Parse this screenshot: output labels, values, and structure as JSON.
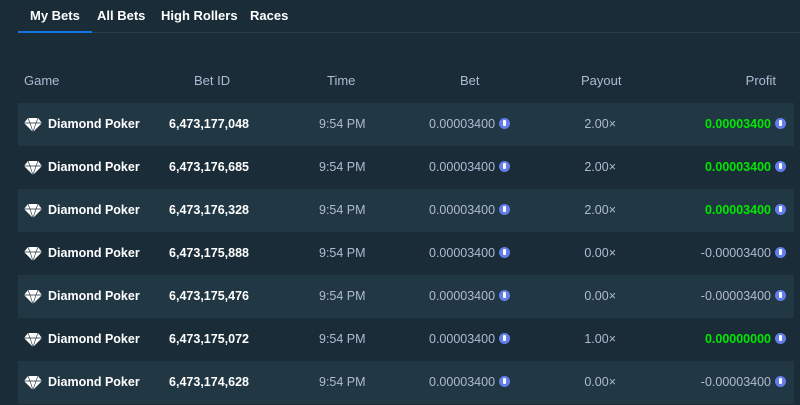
{
  "tabs": [
    {
      "label": "My Bets",
      "active": true
    },
    {
      "label": "All Bets",
      "active": false
    },
    {
      "label": "High Rollers",
      "active": false
    },
    {
      "label": "Races",
      "active": false
    }
  ],
  "columns": {
    "game": "Game",
    "bet_id": "Bet ID",
    "time": "Time",
    "bet": "Bet",
    "payout": "Payout",
    "profit": "Profit"
  },
  "rows": [
    {
      "game": "Diamond Poker",
      "bet_id": "6,473,177,048",
      "time": "9:54 PM",
      "bet": "0.00003400",
      "payout": "2.00×",
      "profit": "0.00003400",
      "profit_sign": "pos"
    },
    {
      "game": "Diamond Poker",
      "bet_id": "6,473,176,685",
      "time": "9:54 PM",
      "bet": "0.00003400",
      "payout": "2.00×",
      "profit": "0.00003400",
      "profit_sign": "pos"
    },
    {
      "game": "Diamond Poker",
      "bet_id": "6,473,176,328",
      "time": "9:54 PM",
      "bet": "0.00003400",
      "payout": "2.00×",
      "profit": "0.00003400",
      "profit_sign": "pos"
    },
    {
      "game": "Diamond Poker",
      "bet_id": "6,473,175,888",
      "time": "9:54 PM",
      "bet": "0.00003400",
      "payout": "0.00×",
      "profit": "-0.00003400",
      "profit_sign": "neg"
    },
    {
      "game": "Diamond Poker",
      "bet_id": "6,473,175,476",
      "time": "9:54 PM",
      "bet": "0.00003400",
      "payout": "0.00×",
      "profit": "-0.00003400",
      "profit_sign": "neg"
    },
    {
      "game": "Diamond Poker",
      "bet_id": "6,473,175,072",
      "time": "9:54 PM",
      "bet": "0.00003400",
      "payout": "1.00×",
      "profit": "0.00000000",
      "profit_sign": "pos"
    },
    {
      "game": "Diamond Poker",
      "bet_id": "6,473,174,628",
      "time": "9:54 PM",
      "bet": "0.00003400",
      "payout": "0.00×",
      "profit": "-0.00003400",
      "profit_sign": "neg"
    }
  ],
  "icons": {
    "game": "diamond-icon",
    "currency": "ethereum-coin-icon"
  },
  "colors": {
    "background": "#1a2c38",
    "row_alt": "#213743",
    "profit_positive": "#00e701",
    "tab_active_underline": "#1475e1"
  }
}
